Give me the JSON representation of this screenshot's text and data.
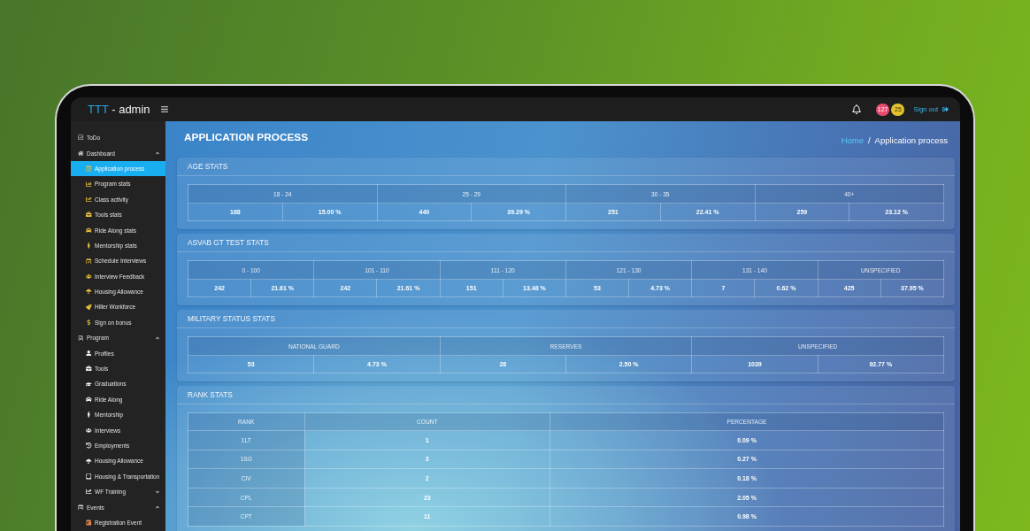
{
  "header": {
    "brand_accent": "TTT",
    "brand_rest": "- admin",
    "badges": [
      {
        "count": "127",
        "color": "#e84a6f"
      },
      {
        "count": "25",
        "color": "#e2c02e"
      }
    ],
    "sign_out": "Sign out"
  },
  "sidebar": {
    "items": [
      {
        "label": "ToDo",
        "selected": false
      },
      {
        "label": "Dashboard",
        "selected": false,
        "expanded": true,
        "children": [
          {
            "label": "Application process",
            "selected": true
          },
          {
            "label": "Program stats",
            "selected": false
          },
          {
            "label": "Class activity",
            "selected": false
          },
          {
            "label": "Tools stats",
            "selected": false
          },
          {
            "label": "Ride Along stats",
            "selected": false
          },
          {
            "label": "Mentorship stats",
            "selected": false
          },
          {
            "label": "Schedule Interviews",
            "selected": false
          },
          {
            "label": "Interview Feedback",
            "selected": false
          },
          {
            "label": "Housing Allowance",
            "selected": false
          },
          {
            "label": "Hiller Workforce",
            "selected": false
          },
          {
            "label": "Sign on bonus",
            "selected": false
          }
        ]
      },
      {
        "label": "Program",
        "selected": false,
        "expanded": true,
        "children": [
          {
            "label": "Profiles",
            "selected": false
          },
          {
            "label": "Tools",
            "selected": false
          },
          {
            "label": "Graduations",
            "selected": false
          },
          {
            "label": "Ride Along",
            "selected": false
          },
          {
            "label": "Mentorship",
            "selected": false
          },
          {
            "label": "Interviews",
            "selected": false
          },
          {
            "label": "Employments",
            "selected": false
          },
          {
            "label": "Housing Allowance",
            "selected": false
          },
          {
            "label": "Housing & Transportation",
            "selected": false
          },
          {
            "label": "WF Training",
            "selected": false,
            "expanded": false
          }
        ]
      },
      {
        "label": "Events",
        "selected": false,
        "expanded": true,
        "children": [
          {
            "label": "Registration Event",
            "selected": false
          }
        ]
      }
    ]
  },
  "page": {
    "title": "APPLICATION PROCESS",
    "breadcrumb": {
      "items": [
        {
          "label": "Home",
          "current": false
        },
        {
          "label": "Application process",
          "current": true
        }
      ],
      "separator": "/"
    }
  },
  "stat_cards": [
    {
      "kind": "grouped",
      "title": "AGE STATS",
      "groups": [
        {
          "label": "18 - 24",
          "count": "168",
          "percent": "15.00 %"
        },
        {
          "label": "25 - 29",
          "count": "440",
          "percent": "39.29 %"
        },
        {
          "label": "30 - 35",
          "count": "251",
          "percent": "22.41 %"
        },
        {
          "label": "40+",
          "count": "259",
          "percent": "23.12 %"
        }
      ]
    },
    {
      "kind": "grouped",
      "title": "ASVAB GT TEST STATS",
      "groups": [
        {
          "label": "0 - 100",
          "count": "242",
          "percent": "21.61 %"
        },
        {
          "label": "101 - 110",
          "count": "242",
          "percent": "21.61 %"
        },
        {
          "label": "111 - 120",
          "count": "151",
          "percent": "13.48 %"
        },
        {
          "label": "121 - 130",
          "count": "53",
          "percent": "4.73 %"
        },
        {
          "label": "131 - 140",
          "count": "7",
          "percent": "0.62 %"
        },
        {
          "label": "UNSPECIFIED",
          "count": "425",
          "percent": "37.95 %"
        }
      ]
    },
    {
      "kind": "grouped",
      "title": "MILITARY STATUS STATS",
      "groups": [
        {
          "label": "NATIONAL GUARD",
          "count": "53",
          "percent": "4.73 %"
        },
        {
          "label": "RESERVES",
          "count": "28",
          "percent": "2.50 %"
        },
        {
          "label": "UNSPECIFIED",
          "count": "1039",
          "percent": "92.77 %"
        }
      ]
    },
    {
      "kind": "table",
      "title": "RANK STATS",
      "columns": [
        "RANK",
        "COUNT",
        "PERCENTAGE"
      ],
      "rows": [
        [
          "1LT",
          "1",
          "0.09 %"
        ],
        [
          "1SG",
          "3",
          "0.27 %"
        ],
        [
          "CIV",
          "2",
          "0.18 %"
        ],
        [
          "CPL",
          "23",
          "2.05 %"
        ],
        [
          "CPT",
          "11",
          "0.98 %"
        ]
      ]
    }
  ]
}
